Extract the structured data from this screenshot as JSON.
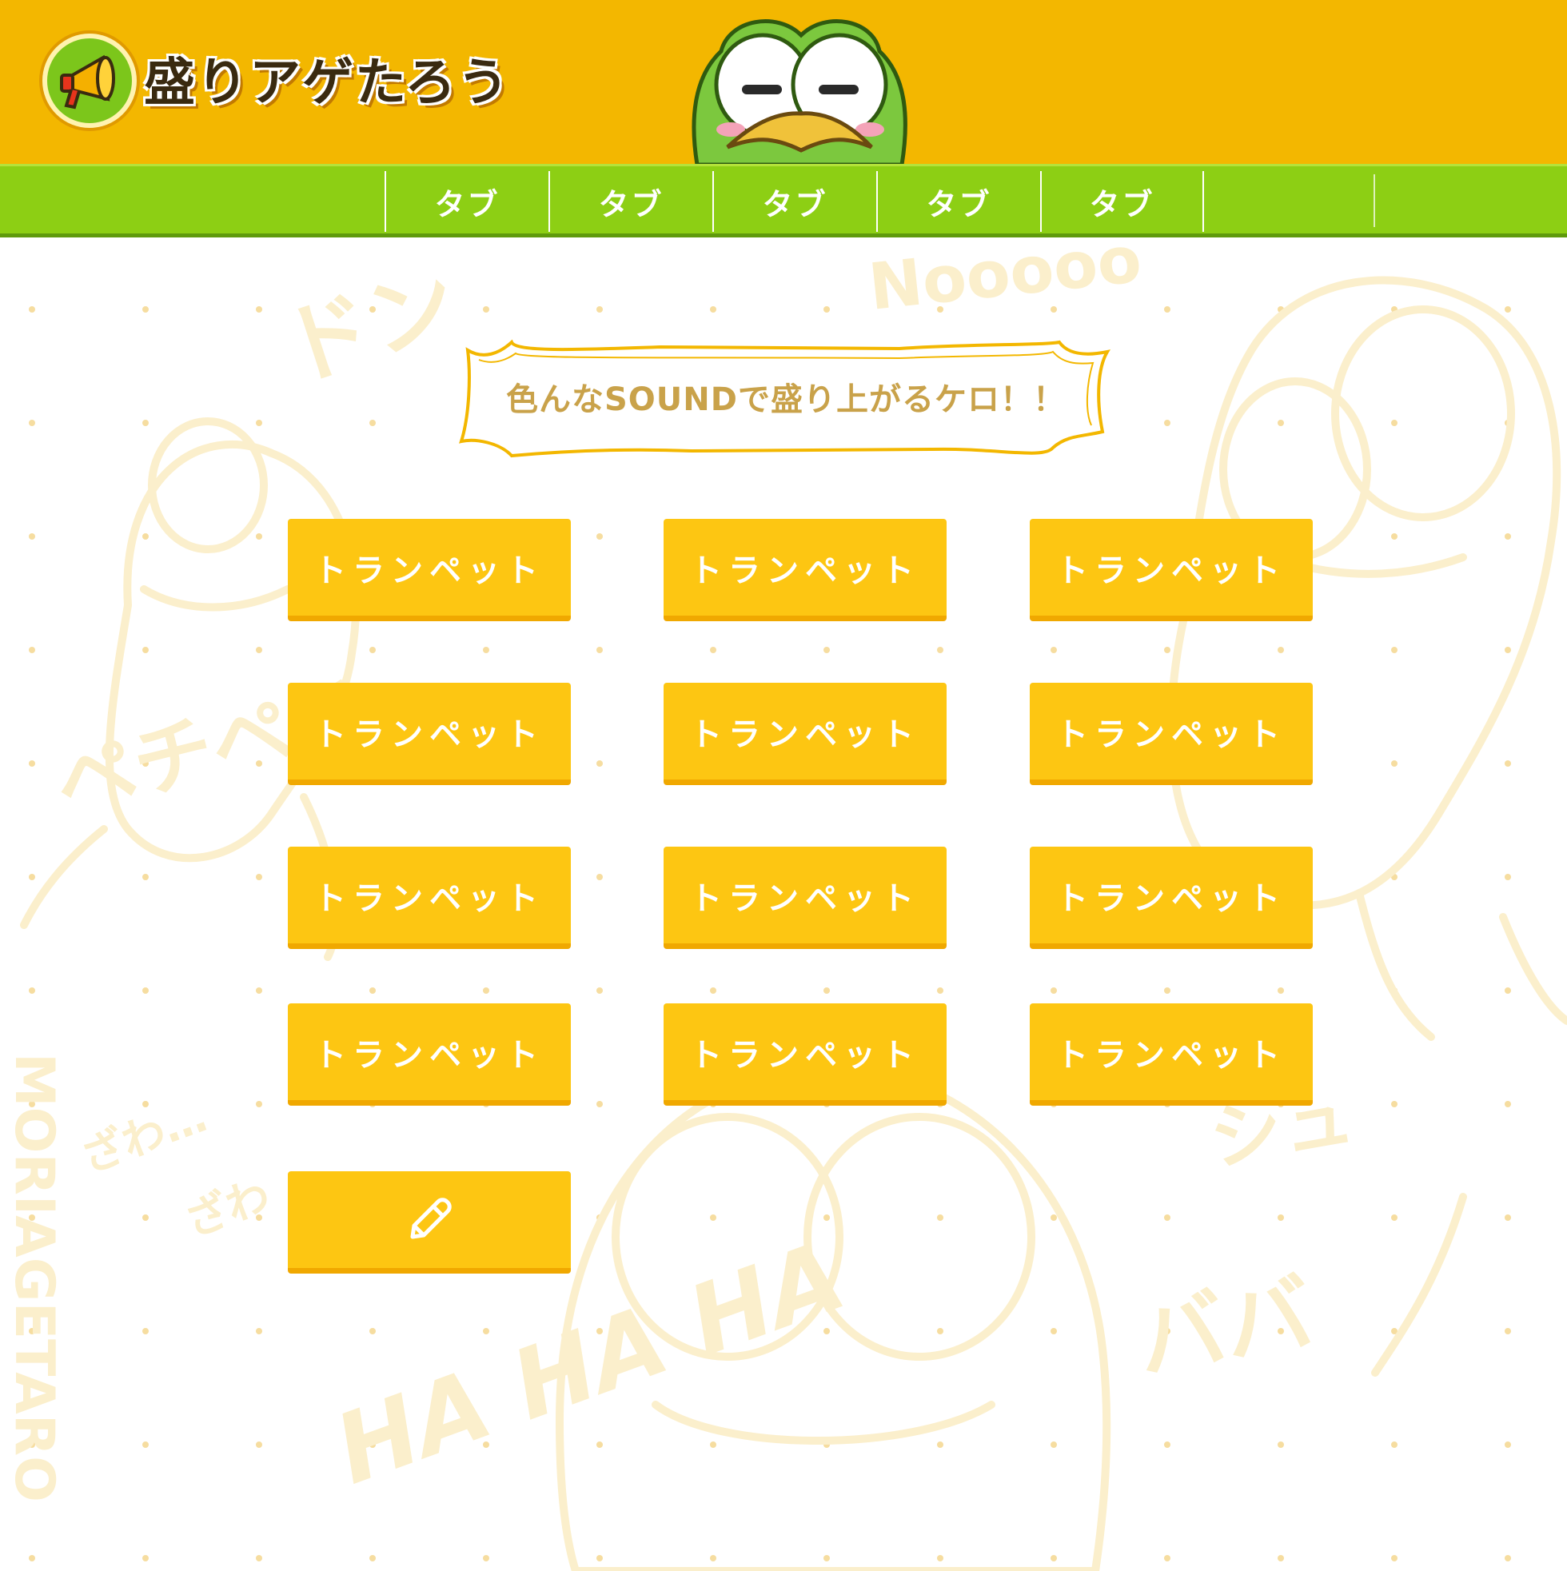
{
  "header": {
    "logo_text": "盛りアゲたろう",
    "logo_icon": "megaphone-icon",
    "mascot_icon": "frog-mascot-icon",
    "background_color": "#f3b700"
  },
  "nav": {
    "background_color": "#8dcf14",
    "tabs": [
      {
        "label": "タブ"
      },
      {
        "label": "タブ"
      },
      {
        "label": "タブ"
      },
      {
        "label": "タブ"
      },
      {
        "label": "タブ"
      }
    ]
  },
  "main": {
    "banner_text": "色んなSOUNDで盛り上がるケロ！！",
    "sound_buttons": [
      {
        "label": "トランペット"
      },
      {
        "label": "トランペット"
      },
      {
        "label": "トランペット"
      },
      {
        "label": "トランペット"
      },
      {
        "label": "トランペット"
      },
      {
        "label": "トランペット"
      },
      {
        "label": "トランペット"
      },
      {
        "label": "トランペット"
      },
      {
        "label": "トランペット"
      },
      {
        "label": "トランペット"
      },
      {
        "label": "トランペット"
      },
      {
        "label": "トランペット"
      }
    ],
    "edit_button_icon": "pencil-icon",
    "button_color": "#fdc612"
  },
  "background_art": {
    "texts": [
      "Nooooo",
      "ドン",
      "ペチペチ",
      "ざわ…",
      "ざわ",
      "HA HA HA",
      "MORIAGETARO",
      "シュ",
      "ババ"
    ]
  }
}
